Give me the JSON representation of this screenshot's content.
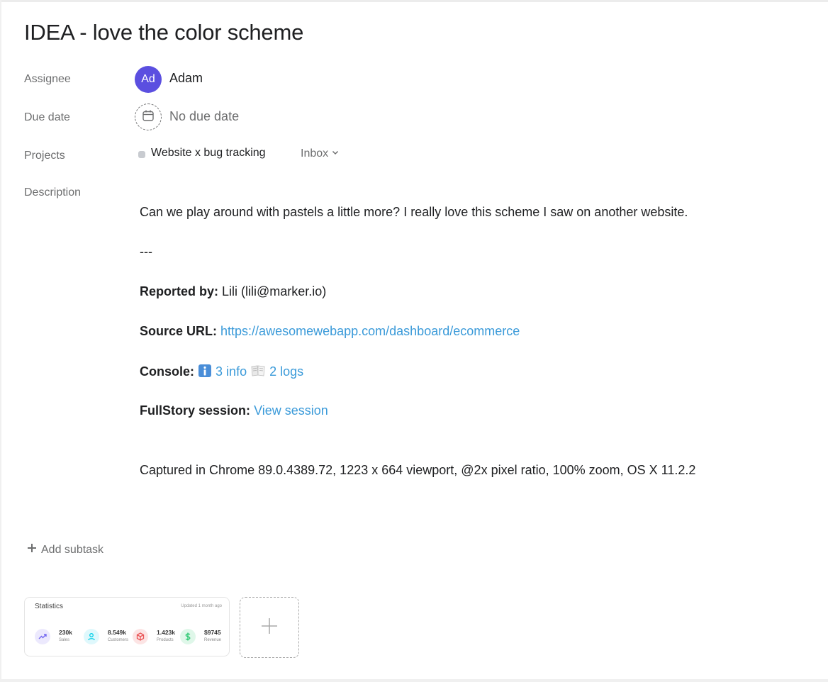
{
  "task": {
    "title": "IDEA - love the color scheme"
  },
  "fields": {
    "assignee_label": "Assignee",
    "due_date_label": "Due date",
    "projects_label": "Projects",
    "description_label": "Description"
  },
  "assignee": {
    "initials": "Ad",
    "name": "Adam",
    "avatar_color": "#5b4fe0"
  },
  "due_date": {
    "value": "No due date",
    "icon": "calendar-icon"
  },
  "project": {
    "name": "Website x bug tracking",
    "section": "Inbox",
    "dot_color": "#c8cbd0"
  },
  "description": {
    "intro": "Can we play around with pastels a little more? I really love this scheme I saw on another website.",
    "separator": "---",
    "reported_by_label": "Reported by:",
    "reported_by_value": " Lili (lili@marker.io)",
    "source_url_label": "Source URL:",
    "source_url": "https://awesomewebapp.com/dashboard/ecommerce",
    "console_label": "Console:",
    "console_info": "3 info",
    "console_logs": "2 logs",
    "fullstory_label": "FullStory session:",
    "fullstory_link": "View session",
    "captured": "Captured in Chrome 89.0.4389.72, 1223 x 664 viewport, @2x pixel ratio, 100% zoom, OS X 11.2.2",
    "link_color": "#3a9ad9"
  },
  "subtask": {
    "add_label": "Add subtask"
  },
  "attachment": {
    "title": "Statistics",
    "updated": "Updated 1 month ago",
    "stats": [
      {
        "value": "230k",
        "label": "Sales",
        "icon": "trending-up-icon",
        "color": "#7367f0"
      },
      {
        "value": "8.549k",
        "label": "Customers",
        "icon": "user-icon",
        "color": "#00cfe8"
      },
      {
        "value": "1.423k",
        "label": "Products",
        "icon": "box-icon",
        "color": "#ea5455"
      },
      {
        "value": "$9745",
        "label": "Revenue",
        "icon": "dollar-icon",
        "color": "#28c76f"
      }
    ]
  }
}
